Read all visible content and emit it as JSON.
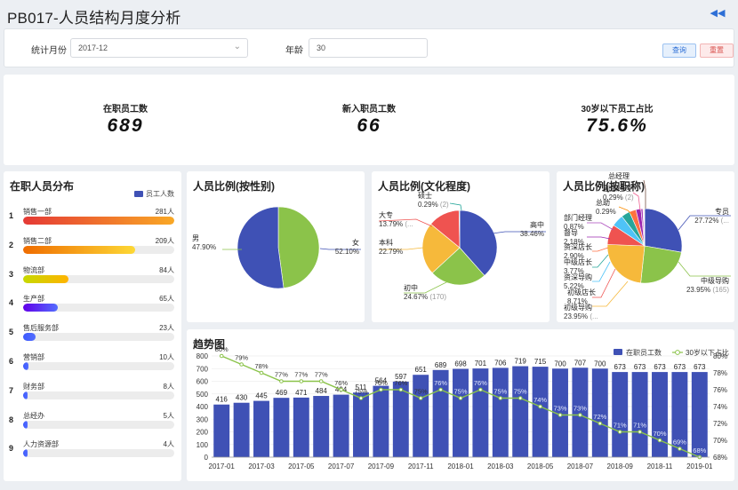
{
  "header": {
    "title": "PB017-人员结构月度分析"
  },
  "filter": {
    "month_label": "统计月份",
    "month_value": "2017-12",
    "age_label": "年龄",
    "age_value": "30",
    "query_label": "查询",
    "reset_label": "重置"
  },
  "kpis": [
    {
      "label": "在职员工数",
      "value": "689"
    },
    {
      "label": "新入职员工数",
      "value": "66"
    },
    {
      "label": "30岁以下员工占比",
      "value": "75.6%"
    }
  ],
  "distribution": {
    "title": "在职人员分布",
    "legend": "员工人数",
    "max": 281,
    "items": [
      {
        "rank": "1",
        "name": "销售一部",
        "count": "281人",
        "value": 281,
        "color": "#e53935"
      },
      {
        "rank": "2",
        "name": "销售二部",
        "count": "209人",
        "value": 209,
        "color": "#f57c00"
      },
      {
        "rank": "3",
        "name": "物流部",
        "count": "84人",
        "value": 84,
        "color": "#c0ca33"
      },
      {
        "rank": "4",
        "name": "生产部",
        "count": "65人",
        "value": 65,
        "color": "#651fff"
      },
      {
        "rank": "5",
        "name": "售后服务部",
        "count": "23人",
        "value": 23,
        "color": "#3d5afe"
      },
      {
        "rank": "6",
        "name": "营销部",
        "count": "10人",
        "value": 10,
        "color": "#3d5afe"
      },
      {
        "rank": "7",
        "name": "财务部",
        "count": "8人",
        "value": 8,
        "color": "#3d5afe"
      },
      {
        "rank": "8",
        "name": "总经办",
        "count": "5人",
        "value": 5,
        "color": "#3d5afe"
      },
      {
        "rank": "9",
        "name": "人力资源部",
        "count": "4人",
        "value": 4,
        "color": "#3d5afe"
      }
    ]
  },
  "chart_data": [
    {
      "type": "pie",
      "title": "人员比例(按性别)",
      "slices": [
        {
          "name": "男",
          "pct": 47.9,
          "label": "47.90%",
          "color": "#8bc34a"
        },
        {
          "name": "女",
          "pct": 52.1,
          "label": "52.10%",
          "color": "#3f51b5"
        }
      ]
    },
    {
      "type": "pie",
      "title": "人员比例(文化程度)",
      "slices": [
        {
          "name": "高中",
          "pct": 38.46,
          "label": "38.46%",
          "color": "#3f51b5"
        },
        {
          "name": "初中",
          "pct": 24.67,
          "label": "24.67%",
          "count": "(170)",
          "color": "#8bc34a"
        },
        {
          "name": "本科",
          "pct": 22.79,
          "label": "22.79%",
          "color": "#f6b93b"
        },
        {
          "name": "大专",
          "pct": 13.79,
          "label": "13.79%",
          "count": "(...",
          "color": "#ef5350"
        },
        {
          "name": "硕士",
          "pct": 0.29,
          "label": "0.29%",
          "count": "(2)",
          "color": "#26a69a"
        }
      ]
    },
    {
      "type": "pie",
      "title": "人员比例(按职称)",
      "slices": [
        {
          "name": "专员",
          "pct": 27.72,
          "label": "27.72%",
          "count": "(...",
          "color": "#3f51b5"
        },
        {
          "name": "中级导购",
          "pct": 23.95,
          "label": "23.95%",
          "count": "(165)",
          "color": "#8bc34a"
        },
        {
          "name": "初级导购",
          "pct": 23.95,
          "label": "23.95%",
          "count": "(...",
          "color": "#f6b93b"
        },
        {
          "name": "初级店长",
          "pct": 8.71,
          "label": "8.71%",
          "color": "#ef5350"
        },
        {
          "name": "资深导购",
          "pct": 5.22,
          "label": "5.22%",
          "color": "#4fc3f7"
        },
        {
          "name": "中级店长",
          "pct": 3.77,
          "label": "3.77%",
          "color": "#26a69a"
        },
        {
          "name": "资深店长",
          "pct": 2.9,
          "label": "2.90%",
          "color": "#ff7043"
        },
        {
          "name": "督导",
          "pct": 2.18,
          "label": "2.18%",
          "color": "#9c27b0"
        },
        {
          "name": "部门经理",
          "pct": 0.87,
          "label": "0.87%",
          "color": "#ab47bc"
        },
        {
          "name": "总助",
          "pct": 0.29,
          "label": "0.29%",
          "color": "#fb8c00"
        },
        {
          "name": "副总经理",
          "pct": 0.29,
          "label": "0.29%",
          "count": "(2)",
          "color": "#f06292"
        },
        {
          "name": "总经理",
          "pct": 0.15,
          "label": "",
          "color": "#795548"
        }
      ]
    },
    {
      "type": "bar+line",
      "title": "趋势图",
      "legend": [
        "在职员工数",
        "30岁以下占比"
      ],
      "categories": [
        "2017-01",
        "2017-02",
        "2017-03",
        "2017-04",
        "2017-05",
        "2017-06",
        "2017-07",
        "2017-08",
        "2017-09",
        "2017-10",
        "2017-11",
        "2017-12",
        "2018-01",
        "2018-02",
        "2018-03",
        "2018-04",
        "2018-05",
        "2018-06",
        "2018-07",
        "2018-08",
        "2018-09",
        "2018-10",
        "2018-11",
        "2018-12",
        "2019-01"
      ],
      "tick_labels": [
        "2017-01",
        "2017-03",
        "2017-05",
        "2017-07",
        "2017-09",
        "2017-11",
        "2018-01",
        "2018-03",
        "2018-05",
        "2018-07",
        "2018-09",
        "2018-11",
        "2019-01"
      ],
      "series": [
        {
          "name": "在职员工数",
          "type": "bar",
          "values": [
            416,
            430,
            445,
            469,
            471,
            484,
            494,
            511,
            564,
            597,
            651,
            689,
            698,
            701,
            706,
            719,
            715,
            700,
            707,
            700,
            673,
            673,
            673,
            673,
            673
          ]
        },
        {
          "name": "30岁以下占比",
          "type": "line",
          "values": [
            80,
            79,
            78,
            77,
            77,
            77,
            76,
            75,
            76,
            76,
            75,
            76,
            75,
            76,
            75,
            75,
            74,
            73,
            73,
            72,
            71,
            71,
            70,
            69,
            68
          ],
          "labels": [
            "80%",
            "79%",
            "78%",
            "77%",
            "77%",
            "77%",
            "76%",
            "75%",
            "76%",
            "76%",
            "75%",
            "76%",
            "75%",
            "76%",
            "75%",
            "75%",
            "74%",
            "73%",
            "73%",
            "72%",
            "71%",
            "71%",
            "70%",
            "69%",
            "68%"
          ]
        }
      ],
      "y_left": {
        "min": 0,
        "max": 800,
        "ticks": [
          "0",
          "100",
          "200",
          "300",
          "400",
          "500",
          "600",
          "700",
          "800"
        ]
      },
      "y_right": {
        "min": 68,
        "max": 80,
        "ticks": [
          "68%",
          "70%",
          "72%",
          "74%",
          "76%",
          "78%",
          "80%"
        ]
      },
      "colors": {
        "bar": "#3f51b5",
        "line": "#8bc34a"
      }
    }
  ]
}
